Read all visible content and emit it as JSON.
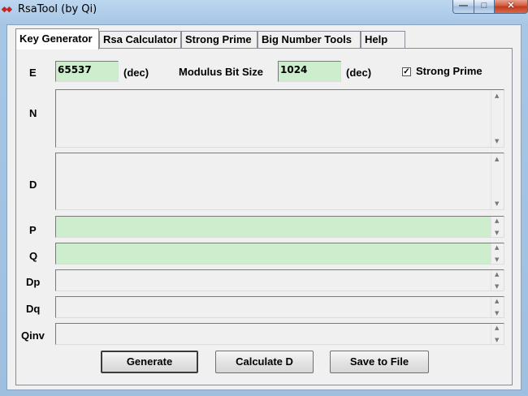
{
  "window": {
    "title": "RsaTool (by Qi)",
    "icon": "app-icon"
  },
  "tabs": [
    {
      "label": "Key Generator",
      "active": true
    },
    {
      "label": "Rsa Calculator",
      "active": false
    },
    {
      "label": "Strong Prime",
      "active": false
    },
    {
      "label": "Big Number Tools",
      "active": false
    },
    {
      "label": "Help",
      "active": false
    }
  ],
  "form": {
    "e_label": "E",
    "e_value": "65537",
    "e_unit": "(dec)",
    "modulus_label": "Modulus Bit Size",
    "modulus_value": "1024",
    "modulus_unit": "(dec)",
    "strong_prime_label": "Strong Prime",
    "strong_prime_checked": true,
    "n_label": "N",
    "d_label": "D",
    "p_label": "P",
    "q_label": "Q",
    "dp_label": "Dp",
    "dq_label": "Dq",
    "qinv_label": "Qinv"
  },
  "buttons": {
    "generate": "Generate",
    "calculate_d": "Calculate D",
    "save": "Save to File"
  },
  "glyphs": {
    "check": "✓",
    "up": "▲",
    "down": "▼",
    "close": "✕",
    "min": "—",
    "max": "□"
  },
  "colors": {
    "field_green": "#cceecc",
    "title_bar": "#a7c6e6"
  }
}
